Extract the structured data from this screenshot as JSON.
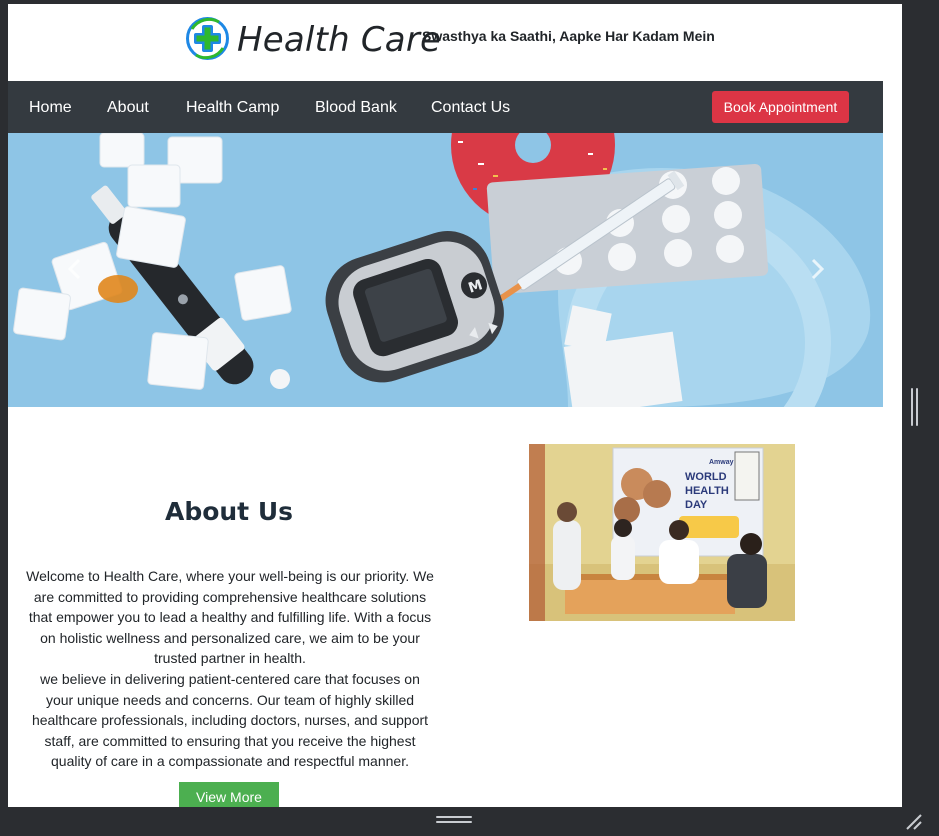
{
  "header": {
    "logo_icon": "medical-cross-logo",
    "brand": "Health Care",
    "tagline": "Swasthya ka Saathi, Aapke Har Kadam Mein"
  },
  "navbar": {
    "items": [
      {
        "label": "Home"
      },
      {
        "label": "About"
      },
      {
        "label": "Health Camp"
      },
      {
        "label": "Blood Bank"
      },
      {
        "label": "Contact Us"
      }
    ],
    "cta_label": "Book Appointment"
  },
  "hero": {
    "image": "diabetes-care-flatlay",
    "prev_icon": "chevron-left-icon",
    "next_icon": "chevron-right-icon",
    "glucometer_button_label": "M"
  },
  "about": {
    "title": "About Us",
    "paragraph_1": "Welcome to Health Care, where your well-being is our priority. We are committed to providing comprehensive healthcare solutions that empower you to lead a healthy and fulfilling life. With a focus on holistic wellness and personalized care, we aim to be your trusted partner in health.",
    "paragraph_2": "we believe in delivering patient-centered care that focuses on your unique needs and concerns. Our team of highly skilled healthcare professionals, including doctors, nurses, and support staff, are committed to ensuring that you receive the highest quality of care in a compassionate and respectful manner.",
    "button_label": "View More",
    "photo": {
      "banner_brand": "Amway",
      "banner_title_1": "WORLD",
      "banner_title_2": "HEALTH",
      "banner_title_3": "DAY"
    }
  },
  "colors": {
    "navbar_bg": "#343a40",
    "cta_bg": "#dc3545",
    "view_more_bg": "#4caf50",
    "logo_blue": "#1e88e5",
    "logo_green": "#2eb82e"
  }
}
